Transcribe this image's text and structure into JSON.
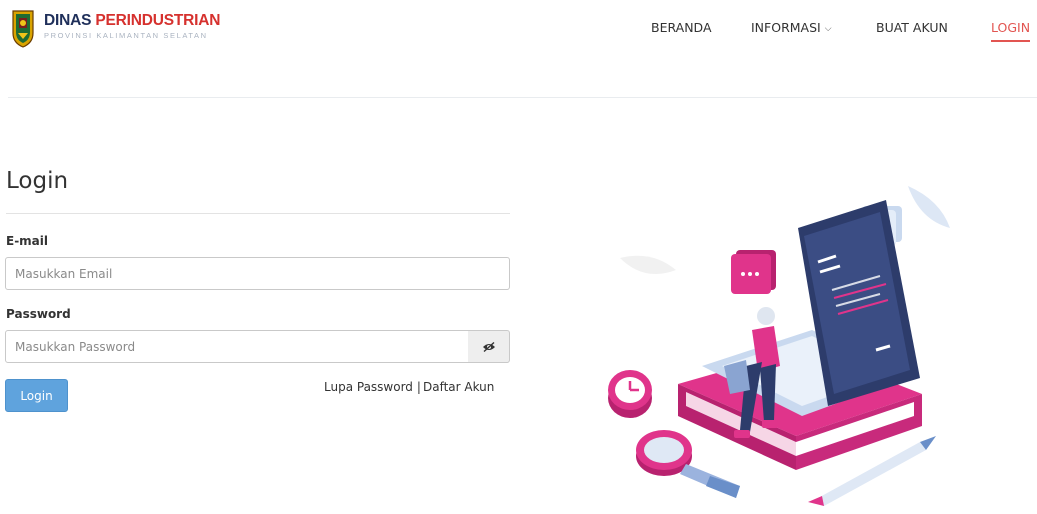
{
  "header": {
    "brand_word1": "DINAS",
    "brand_word2": "PERINDUSTRIAN",
    "brand_subtitle": "PROVINSI KALIMANTAN SELATAN",
    "nav": {
      "beranda": "BERANDA",
      "informasi": "INFORMASI",
      "buat_akun": "BUAT AKUN",
      "login": "LOGIN"
    }
  },
  "form": {
    "title": "Login",
    "email_label": "E-mail",
    "email_placeholder": "Masukkan Email",
    "password_label": "Password",
    "password_placeholder": "Masukkan Password",
    "submit_label": "Login",
    "forgot_label": "Lupa Password",
    "separator": "|",
    "register_label": "Daftar Akun"
  },
  "colors": {
    "accent": "#e25551",
    "brand_navy": "#1f2f5a",
    "button_blue": "#5fa3dd",
    "illustration_pink": "#e0348b"
  },
  "icons": {
    "eye_toggle": "eye-slash-icon",
    "nav_dropdown": "chevron-down-icon"
  }
}
